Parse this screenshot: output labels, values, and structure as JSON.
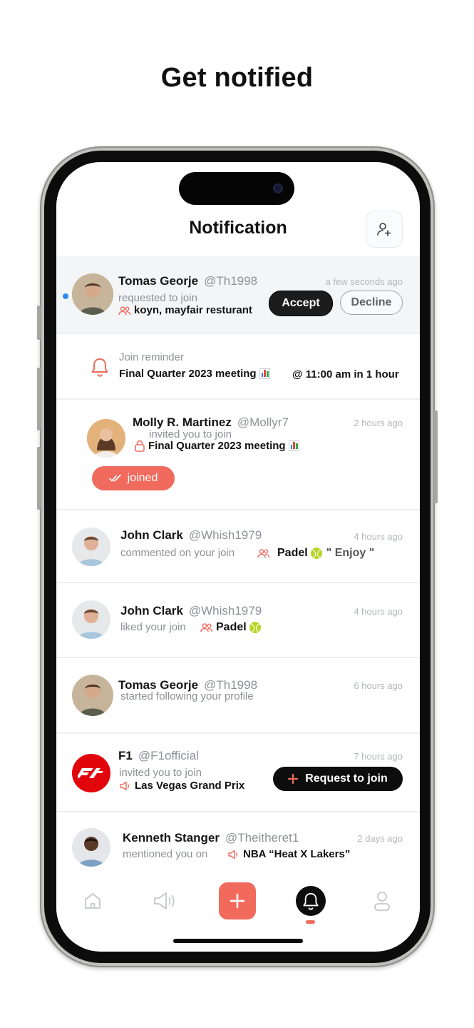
{
  "promo": {
    "title": "Get notified"
  },
  "header": {
    "title": "Notification"
  },
  "notifications": [
    {
      "name": "Tomas Georje",
      "handle": "@Th1998",
      "time": "a few seconds ago",
      "action": "requested to join",
      "target": "koyn, mayfair resturant",
      "accept_label": "Accept",
      "decline_label": "Decline"
    },
    {
      "title": "Join reminder",
      "event": "Final Quarter 2023 meeting",
      "when": "@ 11:00 am in 1 hour"
    },
    {
      "name": "Molly R. Martinez",
      "handle": "@Mollyr7",
      "time": "2 hours ago",
      "action": "invited you to join",
      "target": "Final Quarter 2023 meeting",
      "status_label": "joined"
    },
    {
      "name": "John Clark",
      "handle": "@Whish1979",
      "time": "4 hours ago",
      "action": "commented on your join",
      "target": "Padel",
      "comment": "\" Enjoy \""
    },
    {
      "name": "John Clark",
      "handle": "@Whish1979",
      "time": "4 hours ago",
      "action": "liked your join",
      "target": "Padel"
    },
    {
      "name": "Tomas Georje",
      "handle": "@Th1998",
      "time": "6 hours ago",
      "action": "started following your profile"
    },
    {
      "name": "F1",
      "handle": "@F1official",
      "time": "7 hours ago",
      "action": "invited you to join",
      "target": "Las Vegas Grand Prix",
      "button_label": "Request to join"
    },
    {
      "name": "Kenneth Stanger",
      "handle": "@Theitheret1",
      "time": "2 days ago",
      "action": "mentioned you on",
      "target": "NBA “Heat X Lakers”"
    }
  ],
  "nav": {
    "active": "notifications",
    "items": [
      "home",
      "broadcast",
      "create",
      "notifications",
      "profile"
    ]
  },
  "colors": {
    "accent": "#f06a5e",
    "unread": "#2f8cf5",
    "dark": "#0d0d0d",
    "muted": "#8d9095"
  }
}
